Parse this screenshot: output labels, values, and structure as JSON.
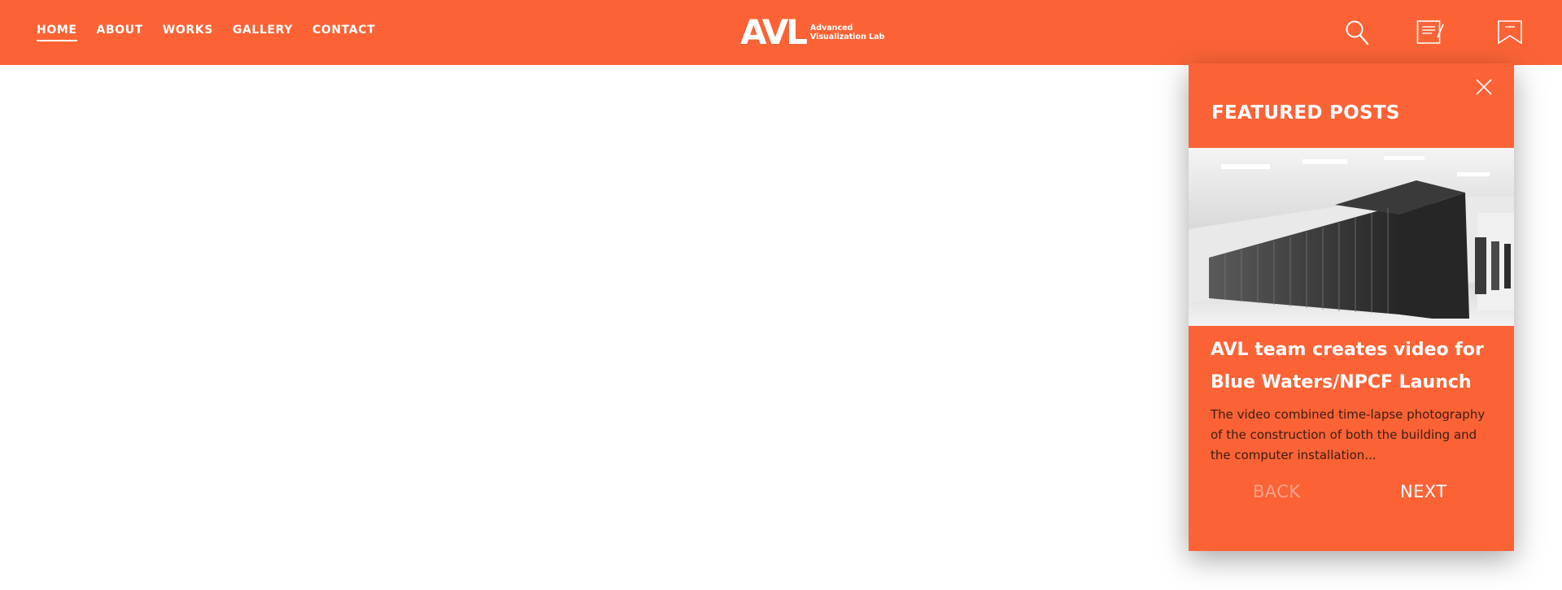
{
  "nav": {
    "items": [
      {
        "label": "HOME",
        "active": true
      },
      {
        "label": "ABOUT"
      },
      {
        "label": "WORKS"
      },
      {
        "label": "GALLERY"
      },
      {
        "label": "CONTACT"
      }
    ]
  },
  "logo": {
    "mark": "AVL",
    "line1": "Advanced",
    "line2": "Visualization Lab"
  },
  "header_icons": [
    "search-icon",
    "posts-icon",
    "bookmark-icon"
  ],
  "featured": {
    "title": "FEATURED POSTS",
    "post": {
      "image_icon": "supercomputer-photo",
      "title": "AVL team creates video for Blue Waters/NPCF Launch",
      "excerpt": "The video combined time-lapse photography of the construction of both the building and the computer installation..."
    },
    "back_label": "BACK",
    "next_label": "NEXT"
  },
  "colors": {
    "brand": "#fb6336",
    "excerpt_text": "#3b1e14",
    "disabled_text": "#fca38a"
  }
}
